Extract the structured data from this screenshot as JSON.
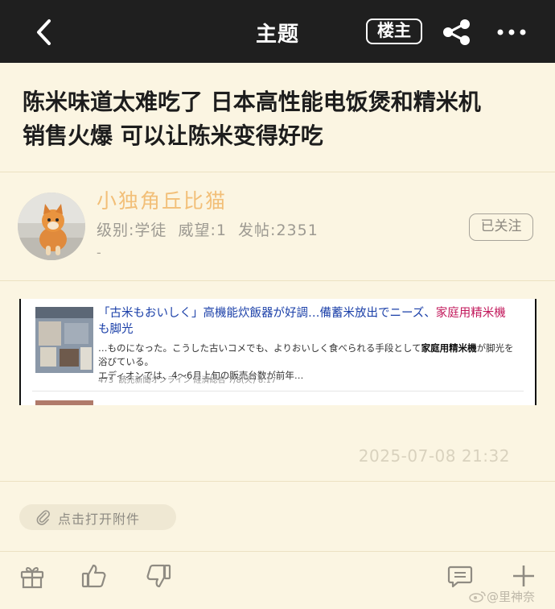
{
  "header": {
    "title": "主题",
    "op_badge": "楼主"
  },
  "post": {
    "title_line1": "陈米味道太难吃了 日本高性能电饭煲和精米机",
    "title_line2": "销售火爆 可以让陈米变得好吃",
    "timestamp": "2025-07-08 21:32"
  },
  "author": {
    "name": "小独角丘比猫",
    "stats": "级别:学徒  威望:1  发帖:2351",
    "signature": "-",
    "follow_label": "已关注"
  },
  "embedded_news": {
    "headline_part1": "「古米もおいしく」高機能炊飯器が好調…備蓄米放出でニーズ、",
    "headline_highlight": "家庭用精米機",
    "headline_part2": "も脚光",
    "snippet_line1_part1": "…ものになった。こうした古いコメでも、よりおいしく食べられる手段として",
    "snippet_line1_bold": "家庭用精米機",
    "snippet_line1_part2": "が脚光を浴びている。",
    "snippet_line2": "エディオンでは、4～6月上旬の販売台数が前年…",
    "meta": "473  読売新聞オンライン 経済総合 7/8(火) 8:17"
  },
  "attachment": {
    "label": "点击打开附件"
  },
  "watermark": {
    "text": "@里神奈"
  },
  "colors": {
    "topbar": "#1f1f1f",
    "page_background": "#fbf5e2",
    "author_name": "#f2bf78",
    "news_link": "#1a3fa8",
    "news_highlight": "#c2185b"
  },
  "icons": [
    "back-icon",
    "share-icon",
    "more-icon",
    "gift-icon",
    "thumbs-up-icon",
    "thumbs-down-icon",
    "comment-icon",
    "plus-icon",
    "paperclip-icon"
  ]
}
